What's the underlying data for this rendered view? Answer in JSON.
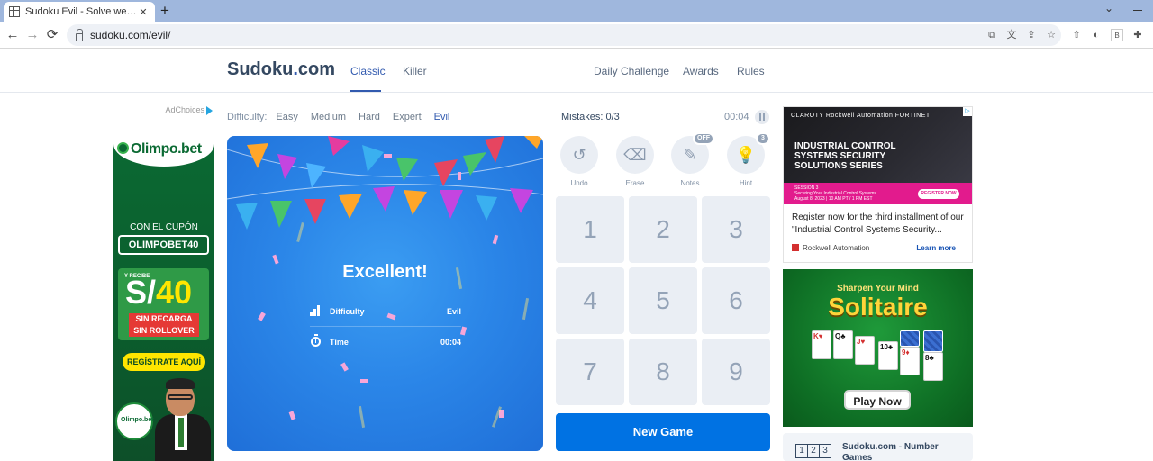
{
  "browser": {
    "tab_title": "Sudoku Evil - Solve web sudoku puzzles",
    "tab_close": "✕",
    "new_tab": "+",
    "tab_menu": "⌄",
    "url": "sudoku.com/evil/"
  },
  "site": {
    "logo_main": "Sudoku",
    "logo_dot": ".",
    "logo_tld": "com",
    "nav": {
      "classic": "Classic",
      "killer": "Killer",
      "daily": "Daily Challenge",
      "awards": "Awards",
      "rules": "Rules"
    }
  },
  "difficulty": {
    "label": "Difficulty:",
    "options": [
      "Easy",
      "Medium",
      "Hard",
      "Expert",
      "Evil"
    ],
    "selected": "Evil"
  },
  "result": {
    "heading": "Excellent!",
    "difficulty_label": "Difficulty",
    "difficulty_value": "Evil",
    "time_label": "Time",
    "time_value": "00:04"
  },
  "status": {
    "mistakes": "Mistakes: 0/3",
    "timer": "00:04"
  },
  "tools": {
    "undo": "Undo",
    "erase": "Erase",
    "notes": "Notes",
    "notes_badge": "OFF",
    "hint": "Hint",
    "hint_badge": "3"
  },
  "numpad": [
    "1",
    "2",
    "3",
    "4",
    "5",
    "6",
    "7",
    "8",
    "9"
  ],
  "new_game": "New Game",
  "left_ad": {
    "adchoices": "AdChoices",
    "brand": "Olimpo.bet",
    "line1": "CON EL CUPÓN",
    "code": "OLIMPOBET40",
    "recibe": "Y RECIBE",
    "currency": "S/",
    "amount": "40",
    "line2": "SIN RECARGA",
    "line3": "SIN ROLLOVER",
    "cta": "REGÍSTRATE AQUÍ",
    "ball_text": "Olimpo.bet"
  },
  "right_ad1": {
    "brands": "CLAROTY   Rockwell Automation   FORTINET",
    "title_line1": "INDUSTRIAL CONTROL",
    "title_line2": "SYSTEMS SECURITY",
    "title_line3": "SOLUTIONS SERIES",
    "session": "SESSION 3",
    "session_desc": "Securing Your Industrial Control Systems",
    "session_date": "August 8, 2023 | 10 AM PT / 1 PM EST",
    "register": "REGISTER NOW",
    "text": "Register now for the third installment of our \"Industrial Control Systems Security...",
    "advertiser": "Rockwell Automation",
    "learn_more": "Learn more"
  },
  "right_ad2": {
    "subtitle": "Sharpen Your Mind",
    "title": "Solitaire",
    "cta": "Play Now",
    "cards": [
      "K",
      "Q",
      "J",
      "10",
      "9",
      "8"
    ]
  },
  "right_card3": {
    "digits": [
      "1",
      "2",
      "3"
    ],
    "title": "Sudoku.com - Number Games"
  },
  "colors": {
    "accent": "#325aaf",
    "primary_button": "#0072e3",
    "board_blue": "#2b86e8"
  }
}
